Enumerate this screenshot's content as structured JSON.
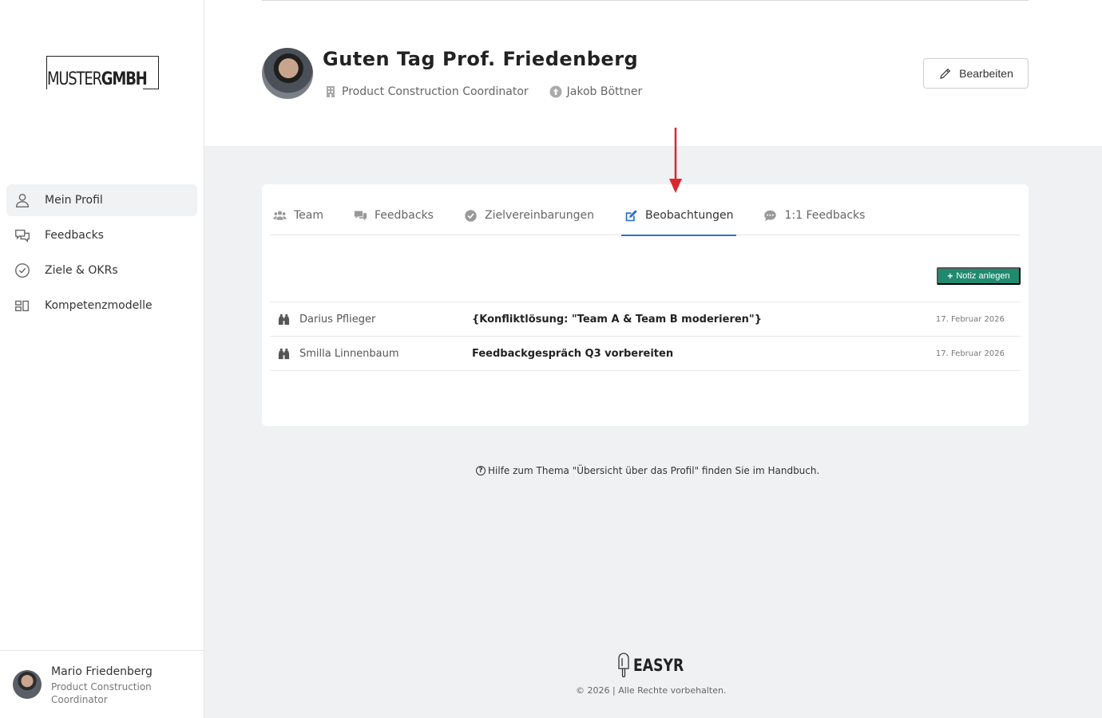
{
  "logo": {
    "thin": "MUSTER",
    "bold": "GMBH"
  },
  "sidebar": {
    "items": [
      {
        "label": "Mein Profil",
        "icon": "user-icon",
        "active": true
      },
      {
        "label": "Feedbacks",
        "icon": "chat-icon",
        "active": false
      },
      {
        "label": "Ziele & OKRs",
        "icon": "check-circle-icon",
        "active": false
      },
      {
        "label": "Kompetenzmodelle",
        "icon": "modules-icon",
        "active": false
      }
    ]
  },
  "user": {
    "name": "Mario Friedenberg",
    "role": "Product Construction Coordinator"
  },
  "profile": {
    "greeting": "Guten Tag Prof. Friedenberg",
    "position": "Product Construction Coordinator",
    "manager": "Jakob Böttner",
    "edit_label": "Bearbeiten"
  },
  "tabs": [
    {
      "label": "Team",
      "icon": "team-icon",
      "active": false
    },
    {
      "label": "Feedbacks",
      "icon": "comments-icon",
      "active": false
    },
    {
      "label": "Zielvereinbarungen",
      "icon": "check-circle-icon",
      "active": false
    },
    {
      "label": "Beobachtungen",
      "icon": "edit-icon",
      "active": true
    },
    {
      "label": "1:1 Feedbacks",
      "icon": "comment-dots-icon",
      "active": false
    }
  ],
  "notes": {
    "add_label": "Notiz anlegen",
    "rows": [
      {
        "person": "Darius Pflieger",
        "title": "{Konfliktlösung: \"Team A & Team B moderieren\"}",
        "date": "17. Februar 2026"
      },
      {
        "person": "Smilla Linnenbaum",
        "title": "Feedbackgespräch Q3 vorbereiten",
        "date": "17. Februar 2026"
      }
    ]
  },
  "help": {
    "icon": "question-icon",
    "text": "Hilfe zum Thema \"Übersicht über das Profil\" finden Sie im Handbuch."
  },
  "footer": {
    "brand": "EASYR",
    "copyright": "© 2026 | Alle Rechte vorbehalten."
  },
  "colors": {
    "accent_blue": "#2f6fd1",
    "accent_green": "#208a6f",
    "arrow_red": "#d9272e"
  }
}
